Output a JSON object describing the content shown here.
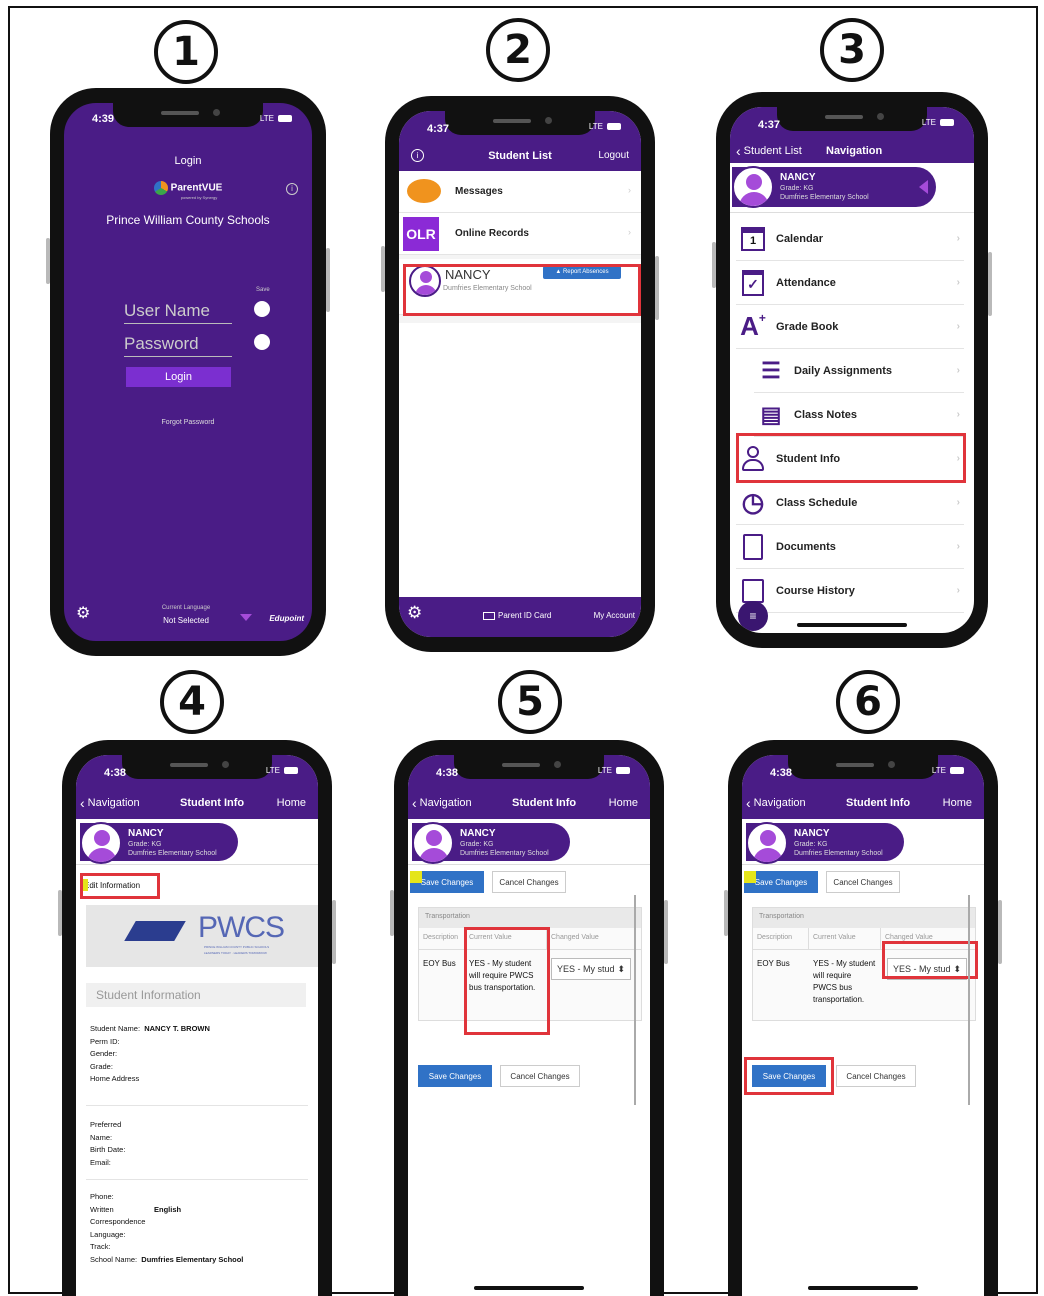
{
  "steps": [
    "1",
    "2",
    "3",
    "4",
    "5",
    "6"
  ],
  "status_time": {
    "p1": "4:39",
    "p2": "4:37",
    "p3": "4:37",
    "p4": "4:38",
    "p5": "4:38",
    "p6": "4:38"
  },
  "network": "LTE",
  "colors": {
    "purple": "#4a1c86",
    "highlight": "#e0343b",
    "button_blue": "#3072c6",
    "avatar": "#a54bd9",
    "messages_icon": "#f0931e",
    "olr_icon": "#8b2ad6"
  },
  "p1": {
    "title": "Login",
    "brand": "ParentVUE",
    "brand_sub": "powered by Synergy",
    "district": "Prince William County Schools",
    "save_label": "Save",
    "username_placeholder": "User Name",
    "password_placeholder": "Password",
    "login_button": "Login",
    "forgot": "Forgot Password",
    "lang_label": "Current Language",
    "lang_value": "Not Selected",
    "vendor": "Edupoint",
    "icons": [
      "info-icon",
      "gear-icon",
      "chevron-down-icon"
    ]
  },
  "p2": {
    "header_title": "Student List",
    "logout": "Logout",
    "messages": "Messages",
    "online_records_badge": "OLR",
    "online_records": "Online Records",
    "student_name": "NANCY",
    "report_absence": "Report Absences",
    "school": "Dumfries Elementary School",
    "footer_id": "Parent ID Card",
    "footer_account": "My Account"
  },
  "p3": {
    "back": "Student List",
    "header_title": "Navigation",
    "student_name": "NANCY",
    "grade": "Grade: KG",
    "school": "Dumfries Elementary School",
    "calendar_num": "1",
    "items": [
      "Calendar",
      "Attendance",
      "Grade Book",
      "Daily Assignments",
      "Class Notes",
      "Student Info",
      "Class Schedule",
      "Documents",
      "Course History"
    ]
  },
  "p4": {
    "back": "Navigation",
    "header_title": "Student Info",
    "home": "Home",
    "student_name": "NANCY",
    "grade": "Grade: KG",
    "school": "Dumfries Elementary School",
    "edit": "Edit Information",
    "logo_text": "PWCS",
    "logo_sub1": "PRINCE WILLIAM COUNTY PUBLIC SCHOOLS",
    "logo_sub2": "LEARNERS TODAY · LEADERS TOMORROW",
    "section": "Student Information",
    "student_name_label": "Student Name:",
    "student_name_value": "NANCY T. BROWN",
    "perm_id": "Perm ID:",
    "gender": "Gender:",
    "grade_label": "Grade:",
    "home_address": "Home Address",
    "preferred": "Preferred",
    "name_label": "Name:",
    "birth_date": "Birth Date:",
    "email": "Email:",
    "phone": "Phone:",
    "written": "Written",
    "written_value": "English",
    "correspondence": "Correspondence",
    "language_label": "Language:",
    "track": "Track:",
    "school_name_label": "School Name:",
    "school_name_value": "Dumfries Elementary School"
  },
  "p5": {
    "back": "Navigation",
    "header_title": "Student Info",
    "home": "Home",
    "student_name": "NANCY",
    "grade": "Grade: KG",
    "school": "Dumfries Elementary School",
    "save_top": "Save Changes",
    "cancel_top": "Cancel Changes",
    "caption": "Transportation",
    "col_desc": "Description",
    "col_current": "Current Value",
    "col_changed": "Changed Value",
    "desc": "EOY Bus",
    "current": "YES - My student will require PWCS bus transportation.",
    "changed": "YES - My stud",
    "save_bottom": "Save Changes",
    "cancel_bottom": "Cancel Changes"
  },
  "p6": {
    "back": "Navigation",
    "header_title": "Student Info",
    "home": "Home",
    "student_name": "NANCY",
    "grade": "Grade: KG",
    "school": "Dumfries Elementary School",
    "save_top": "Save Changes",
    "cancel_top": "Cancel Changes",
    "caption": "Transportation",
    "col_desc": "Description",
    "col_current": "Current Value",
    "col_changed": "Changed Value",
    "desc": "EOY Bus",
    "current": "YES - My student will require PWCS bus transportation.",
    "changed": "YES - My stud",
    "save_bottom": "Save Changes",
    "cancel_bottom": "Cancel Changes"
  }
}
